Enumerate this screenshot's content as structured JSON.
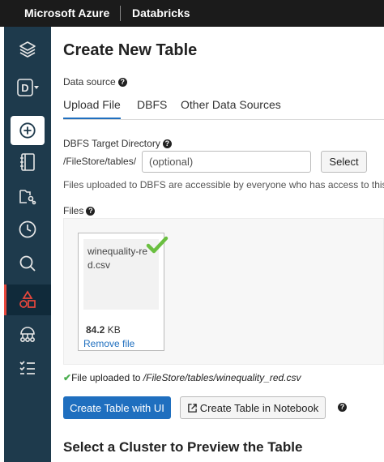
{
  "topbar": {
    "brand": "Microsoft Azure",
    "product": "Databricks"
  },
  "sidebar": {
    "items": [
      {
        "icon": "layers-icon"
      },
      {
        "icon": "workspace-d-icon",
        "letter": "D"
      },
      {
        "icon": "create-plus-icon"
      },
      {
        "icon": "notebook-icon"
      },
      {
        "icon": "folder-icon"
      },
      {
        "icon": "clock-icon"
      },
      {
        "icon": "search-icon"
      },
      {
        "icon": "shapes-icon",
        "active": true
      },
      {
        "icon": "cluster-icon"
      },
      {
        "icon": "jobs-list-icon"
      }
    ],
    "active_color": "#e8473c"
  },
  "page": {
    "title": "Create New Table",
    "data_source_label": "Data source",
    "tabs": [
      {
        "label": "Upload File",
        "active": true
      },
      {
        "label": "DBFS"
      },
      {
        "label": "Other Data Sources"
      }
    ],
    "dbfs": {
      "label": "DBFS Target Directory",
      "prefix": "/FileStore/tables/",
      "placeholder": "(optional)",
      "select_label": "Select",
      "note": "Files uploaded to DBFS are accessible by everyone who has access to this"
    },
    "files": {
      "label": "Files",
      "file_name": "winequality-red.csv",
      "file_size_value": "84.2",
      "file_size_unit": "KB",
      "remove_label": "Remove file"
    },
    "upload_status": {
      "prefix": "File uploaded to ",
      "path": "/FileStore/tables/winequality_red.csv"
    },
    "buttons": {
      "create_ui": "Create Table with UI",
      "create_notebook": "Create Table in Notebook"
    },
    "cluster_section_title": "Select a Cluster to Preview the Table"
  },
  "colors": {
    "accent": "#1f6fbf",
    "sidebar": "#1e3a4c",
    "success": "#4caf50"
  }
}
